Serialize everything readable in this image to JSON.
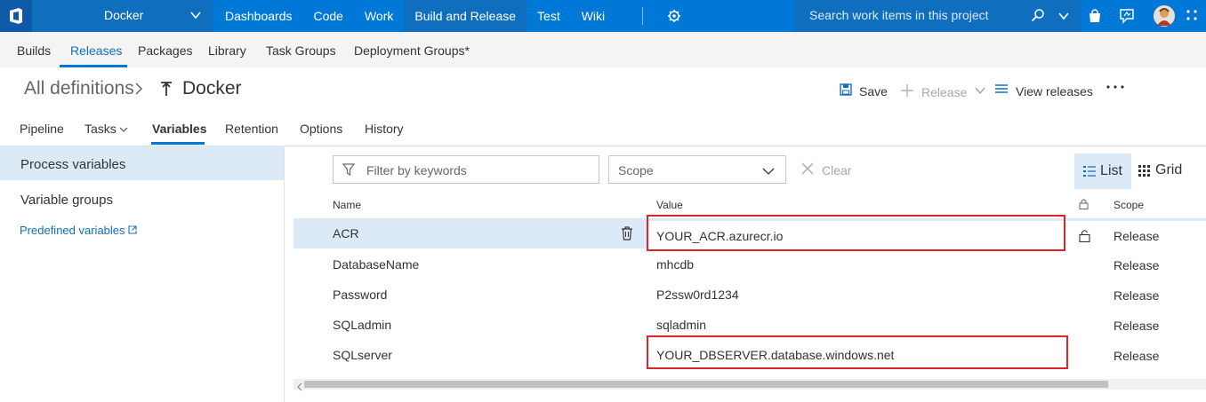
{
  "topbar": {
    "project": "Docker",
    "nav": [
      "Dashboards",
      "Code",
      "Work",
      "Build and Release",
      "Test",
      "Wiki"
    ],
    "active_nav": "Build and Release",
    "search_placeholder": "Search work items in this project"
  },
  "hubs": [
    "Builds",
    "Releases",
    "Packages",
    "Library",
    "Task Groups",
    "Deployment Groups*"
  ],
  "active_hub": "Releases",
  "breadcrumb": {
    "root": "All definitions",
    "title": "Docker"
  },
  "toolbar": {
    "save": "Save",
    "release": "Release",
    "view_releases": "View releases"
  },
  "tabs": [
    "Pipeline",
    "Tasks",
    "Variables",
    "Retention",
    "Options",
    "History"
  ],
  "active_tab": "Variables",
  "left_panel": {
    "process_variables": "Process variables",
    "variable_groups": "Variable groups",
    "predefined_variables": "Predefined variables"
  },
  "filters": {
    "keyword_placeholder": "Filter by keywords",
    "scope_value": "Scope",
    "clear_label": "Clear",
    "list_label": "List",
    "grid_label": "Grid"
  },
  "table": {
    "headers": {
      "name": "Name",
      "value": "Value",
      "scope": "Scope"
    },
    "rows": [
      {
        "name": "ACR",
        "value": "YOUR_ACR.azurecr.io",
        "scope": "Release"
      },
      {
        "name": "DatabaseName",
        "value": "mhcdb",
        "scope": "Release"
      },
      {
        "name": "Password",
        "value": "P2ssw0rd1234",
        "scope": "Release"
      },
      {
        "name": "SQLadmin",
        "value": "sqladmin",
        "scope": "Release"
      },
      {
        "name": "SQLserver",
        "value": "YOUR_DBSERVER.database.windows.net",
        "scope": "Release"
      }
    ]
  },
  "colors": {
    "accent": "#0078d7",
    "selection": "#dceaf7",
    "highlight": "#d9262c"
  }
}
